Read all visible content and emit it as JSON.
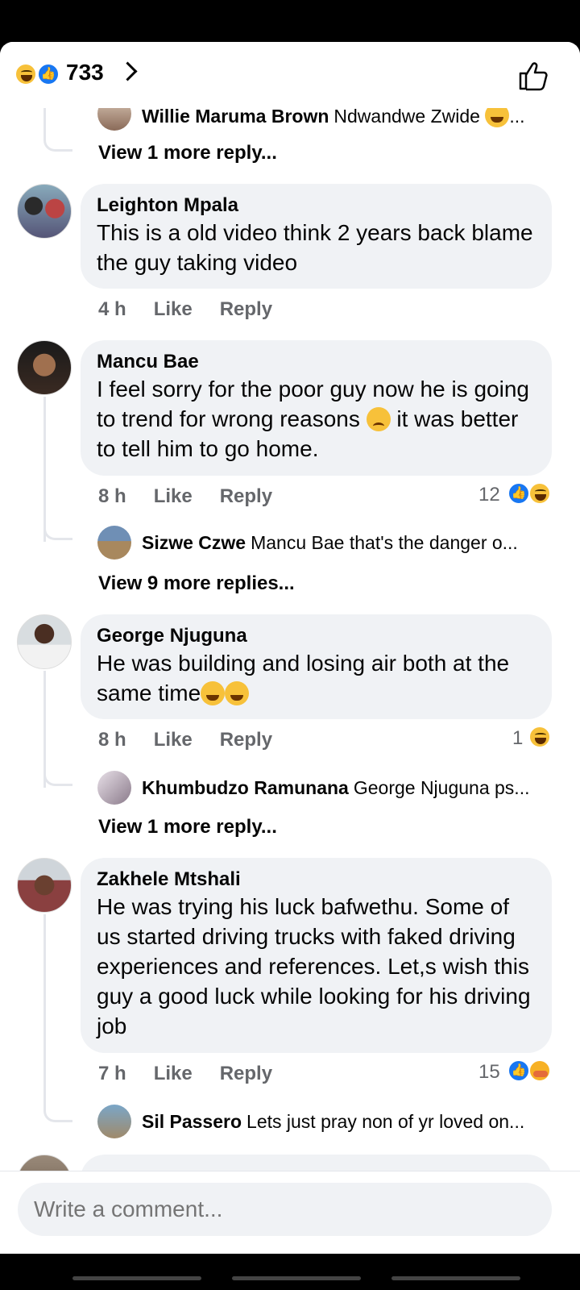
{
  "header": {
    "reaction_count": "733"
  },
  "comments": [
    {
      "name": "Leighton Mpala",
      "text": "This is a old video think 2 years back blame the guy taking video",
      "time": "4 h",
      "like": "Like",
      "reply": "Reply"
    },
    {
      "name": "Mancu Bae",
      "text_a": "I feel sorry for the poor guy now he is going to trend  for  wrong reasons ",
      "text_b": " it was better to  tell him to go home.",
      "time": "8 h",
      "like": "Like",
      "reply": "Reply",
      "reactions": "12"
    },
    {
      "name": "George Njuguna",
      "text": "He was building and losing air both at the same time",
      "time": "8 h",
      "like": "Like",
      "reply": "Reply",
      "reactions": "1"
    },
    {
      "name": "Zakhele Mtshali",
      "text": "He was trying his luck bafwethu. Some of us started driving trucks with faked driving experiences and references. Let,s wish this guy a good luck while looking for his driving job",
      "time": "7 h",
      "like": "Like",
      "reply": "Reply",
      "reactions": "15"
    }
  ],
  "replies": [
    {
      "name": "Willie Maruma Brown",
      "text": "Ndwandwe Zwide",
      "suffix": "..."
    },
    {
      "name": "Sizwe Czwe",
      "text": "Mancu Bae  that's the danger o..."
    },
    {
      "name": "Khumbudzo Ramunana",
      "text": "George Njuguna ps..."
    },
    {
      "name": "Sil Passero",
      "text": "Lets just pray non of yr loved on..."
    }
  ],
  "view_more": [
    "View 1 more reply...",
    "View 9 more replies...",
    "View 1 more reply..."
  ],
  "composer": {
    "placeholder": "Write a comment..."
  },
  "colors": {
    "accent": "#1877f2",
    "bubble": "#f0f2f5",
    "meta": "#65676b"
  }
}
